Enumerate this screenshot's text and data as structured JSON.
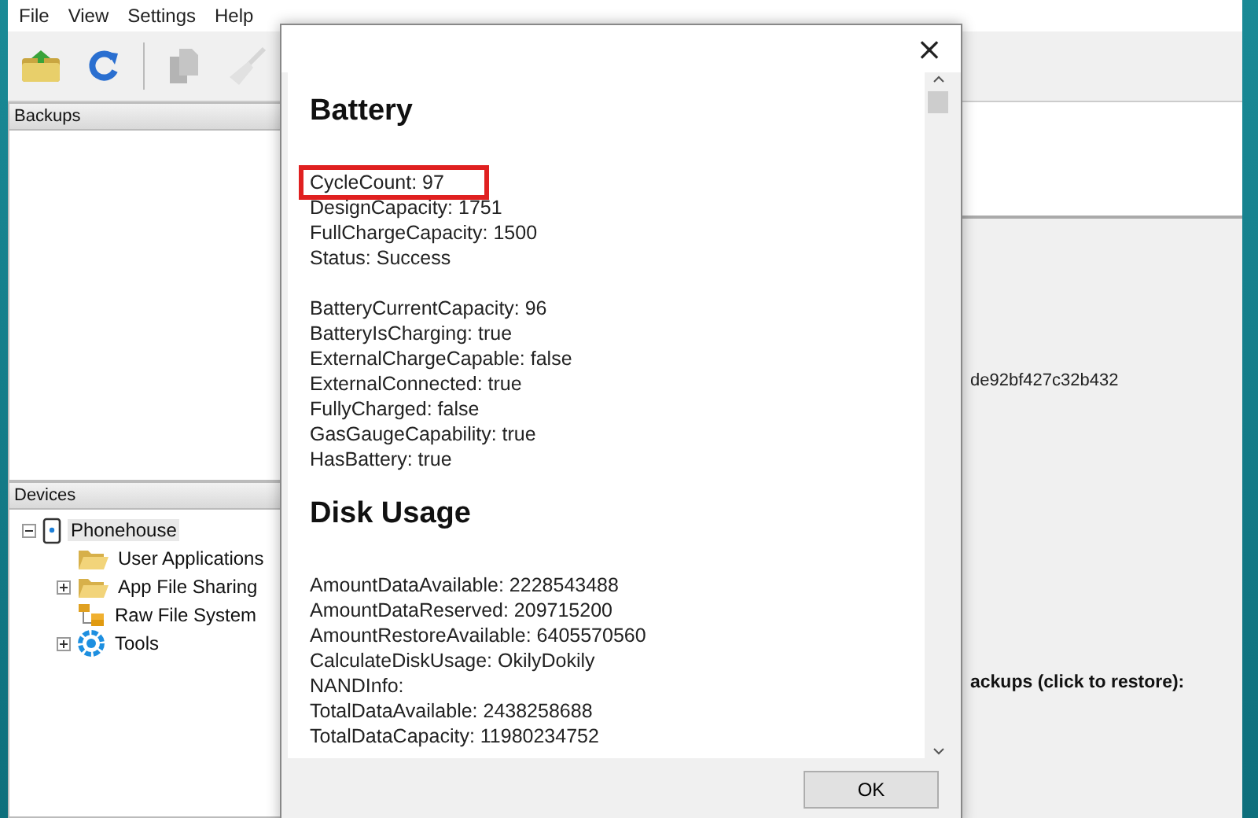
{
  "menu": [
    "File",
    "View",
    "Settings",
    "Help"
  ],
  "toolbar": [
    {
      "kind": "open",
      "disabled": false
    },
    {
      "kind": "refresh",
      "disabled": false
    },
    {
      "kind": "separator"
    },
    {
      "kind": "copy",
      "disabled": true
    },
    {
      "kind": "clean",
      "disabled": true
    }
  ],
  "backups_panel": {
    "title": "Backups"
  },
  "devices_panel": {
    "title": "Devices",
    "tree": [
      {
        "label": "Phonehouse",
        "kind": "phone",
        "expanded": true,
        "selected": true,
        "children": [
          {
            "label": "User Applications",
            "kind": "folder",
            "selected": false
          },
          {
            "label": "App File Sharing",
            "kind": "folder",
            "expanded": false,
            "selected": false
          },
          {
            "label": "Raw File System",
            "kind": "filesystem",
            "selected": false
          },
          {
            "label": "Tools",
            "kind": "tools",
            "expanded": false,
            "selected": false
          }
        ]
      }
    ]
  },
  "details": {
    "id_text": "de92bf427c32b432",
    "backups_label": "ackups (click to restore):"
  },
  "dialog": {
    "close": "×",
    "sections": [
      {
        "title": "Battery",
        "groups": [
          [
            {
              "text": "CycleCount: 97",
              "highlighted": true
            },
            {
              "text": "DesignCapacity: 1751",
              "highlighted": false
            },
            {
              "text": "FullChargeCapacity: 1500",
              "highlighted": false
            },
            {
              "text": "Status: Success",
              "highlighted": false
            }
          ],
          [
            {
              "text": "BatteryCurrentCapacity: 96",
              "highlighted": false
            },
            {
              "text": "BatteryIsCharging: true",
              "highlighted": false
            },
            {
              "text": "ExternalChargeCapable: false",
              "highlighted": false
            },
            {
              "text": "ExternalConnected: true",
              "highlighted": false
            },
            {
              "text": "FullyCharged: false",
              "highlighted": false
            },
            {
              "text": "GasGaugeCapability: true",
              "highlighted": false
            },
            {
              "text": "HasBattery: true",
              "highlighted": false
            }
          ]
        ]
      },
      {
        "title": "Disk Usage",
        "groups": [
          [
            {
              "text": "AmountDataAvailable: 2228543488",
              "highlighted": false
            },
            {
              "text": "AmountDataReserved: 209715200",
              "highlighted": false
            },
            {
              "text": "AmountRestoreAvailable: 6405570560",
              "highlighted": false
            },
            {
              "text": "CalculateDiskUsage: OkilyDokily",
              "highlighted": false
            },
            {
              "text": "NANDInfo:",
              "highlighted": false
            },
            {
              "text": "TotalDataAvailable: 2438258688",
              "highlighted": false
            },
            {
              "text": "TotalDataCapacity: 11980234752",
              "highlighted": false
            }
          ]
        ]
      }
    ],
    "ok_button": "OK"
  }
}
